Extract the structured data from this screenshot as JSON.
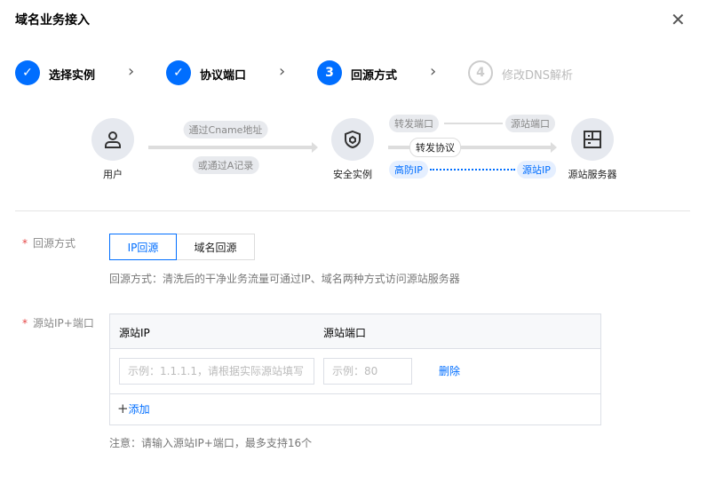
{
  "dialog": {
    "title": "域名业务接入",
    "close_icon": "close-icon"
  },
  "steps": [
    {
      "label": "选择实例",
      "status": "done"
    },
    {
      "label": "协议端口",
      "status": "done"
    },
    {
      "num": "3",
      "label": "回源方式",
      "status": "current"
    },
    {
      "num": "4",
      "label": "修改DNS解析",
      "status": "todo"
    }
  ],
  "diagram": {
    "user": "用户",
    "cname": "通过Cname地址",
    "arecord": "或通过A记录",
    "instance": "安全实例",
    "fwd_port": "转发端口",
    "src_port": "源站端口",
    "fwd_protocol": "转发协议",
    "hf_ip": "高防IP",
    "src_ip": "源站IP",
    "server": "源站服务器"
  },
  "form": {
    "origin_mode": {
      "label": "回源方式",
      "options": [
        "IP回源",
        "域名回源"
      ],
      "selected": "IP回源",
      "help": "回源方式：清洗后的干净业务流量可通过IP、域名两种方式访问源站服务器"
    },
    "origin_ip": {
      "label": "源站IP+端口",
      "columns": [
        "源站IP",
        "源站端口"
      ],
      "ip_placeholder": "示例：1.1.1.1，请根据实际源站填写",
      "port_placeholder": "示例：80",
      "delete": "删除",
      "add": "添加",
      "note": "注意：请输入源站IP+端口，最多支持16个"
    }
  },
  "colors": {
    "primary": "#006eff",
    "required": "#e54545"
  }
}
